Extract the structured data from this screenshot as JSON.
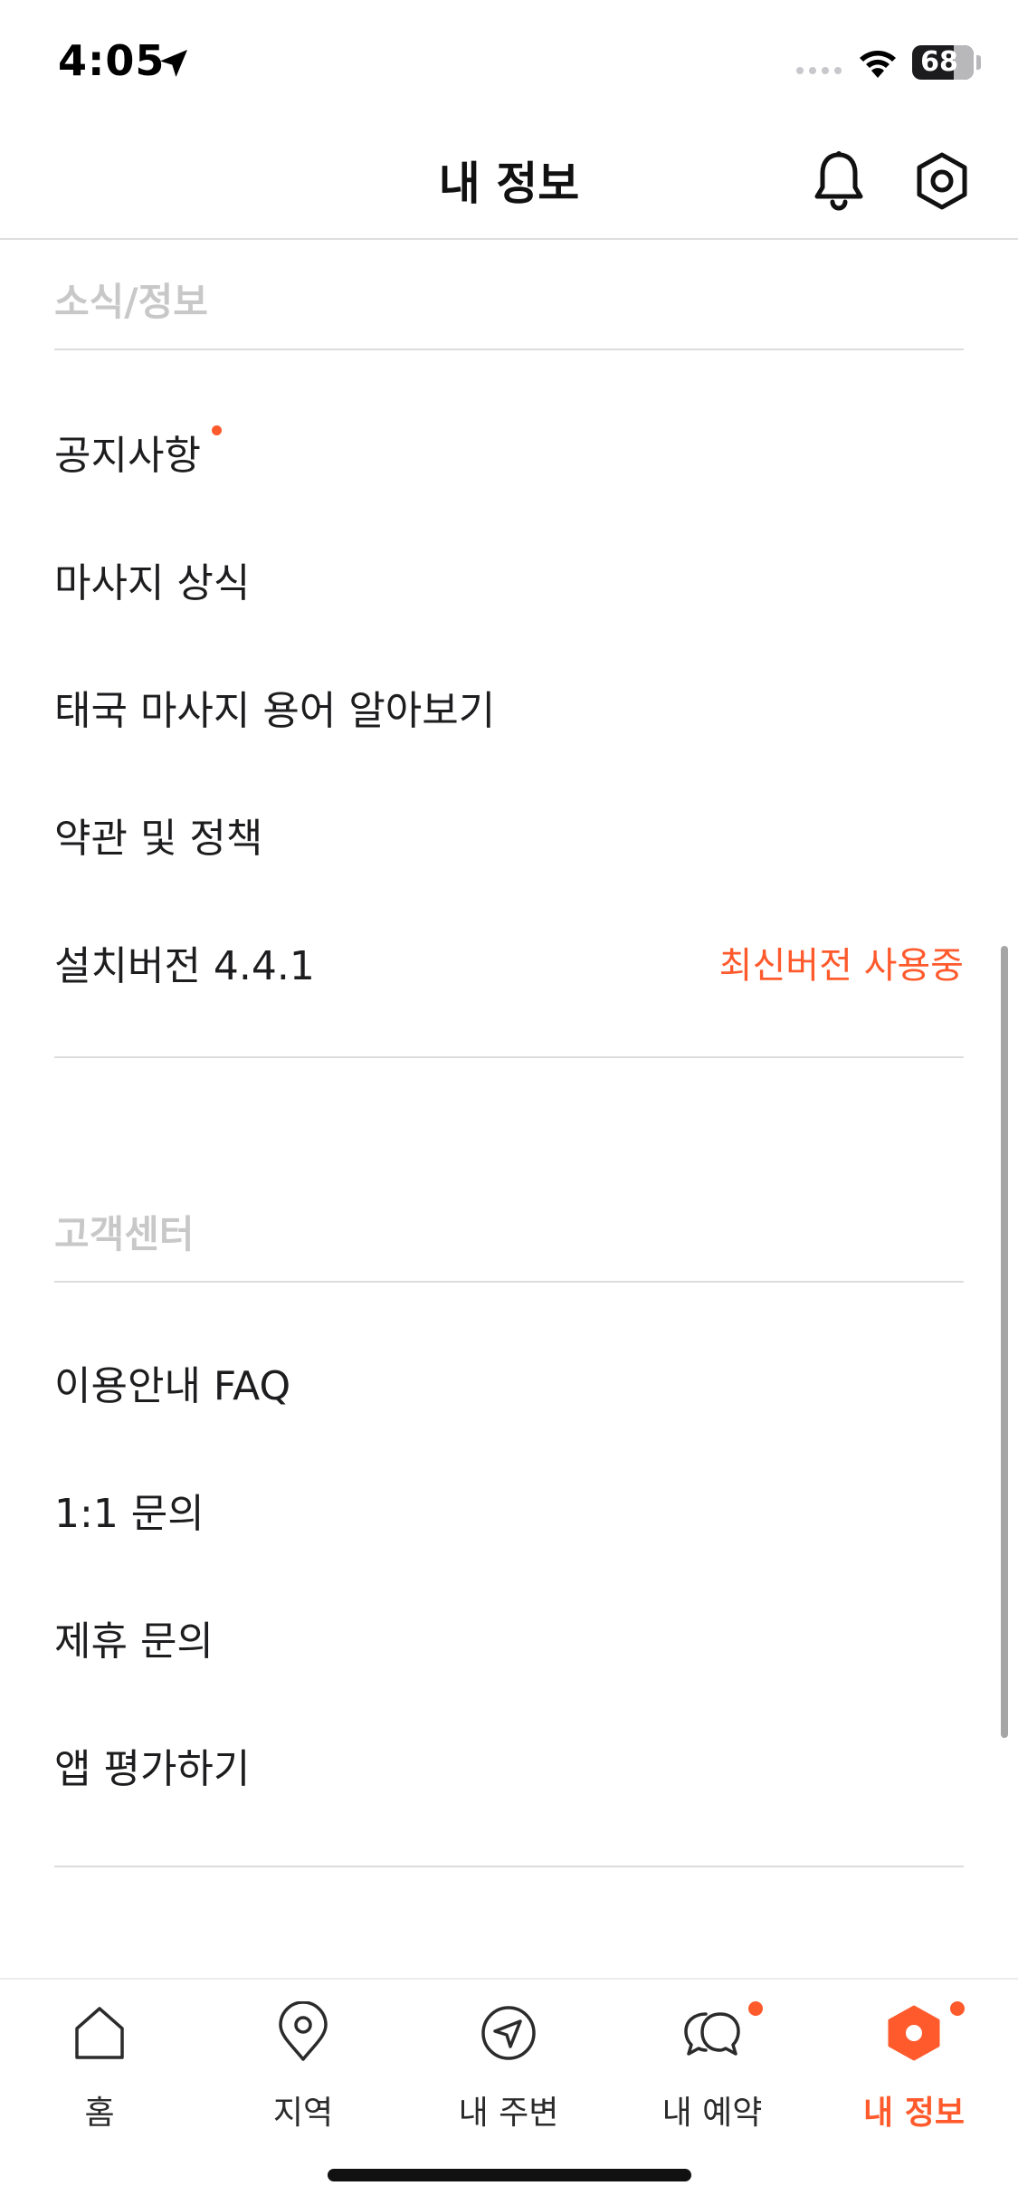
{
  "status_bar": {
    "time": "4:05",
    "battery_level": "68",
    "battery_fraction": 0.68
  },
  "header": {
    "title": "내 정보",
    "icons": [
      "bell-icon",
      "settings-hexagon-icon"
    ]
  },
  "sections": {
    "news": {
      "title": "소식/정보",
      "items": {
        "notice": "공지사항",
        "massage_tips": "마사지 상식",
        "thai_terms": "태국 마사지 용어 알아보기",
        "terms_policy": "약관 및 정책",
        "version": "설치버전 4.4.1",
        "version_status": "최신버전 사용중"
      }
    },
    "support": {
      "title": "고객센터",
      "items": {
        "faq": "이용안내 FAQ",
        "inquiry": "1:1 문의",
        "partnership": "제휴 문의",
        "rate_app": "앱 평가하기"
      }
    }
  },
  "tab_bar": {
    "home": "홈",
    "region": "지역",
    "nearby": "내 주변",
    "reservations": "내 예약",
    "my_info": "내 정보",
    "active_tab": "my_info",
    "accent_color": "#ff5a2c",
    "icons": [
      "home-icon",
      "map-pin-icon",
      "navigation-arrow-icon",
      "chat-bubbles-icon",
      "hexagon-profile-icon"
    ]
  }
}
